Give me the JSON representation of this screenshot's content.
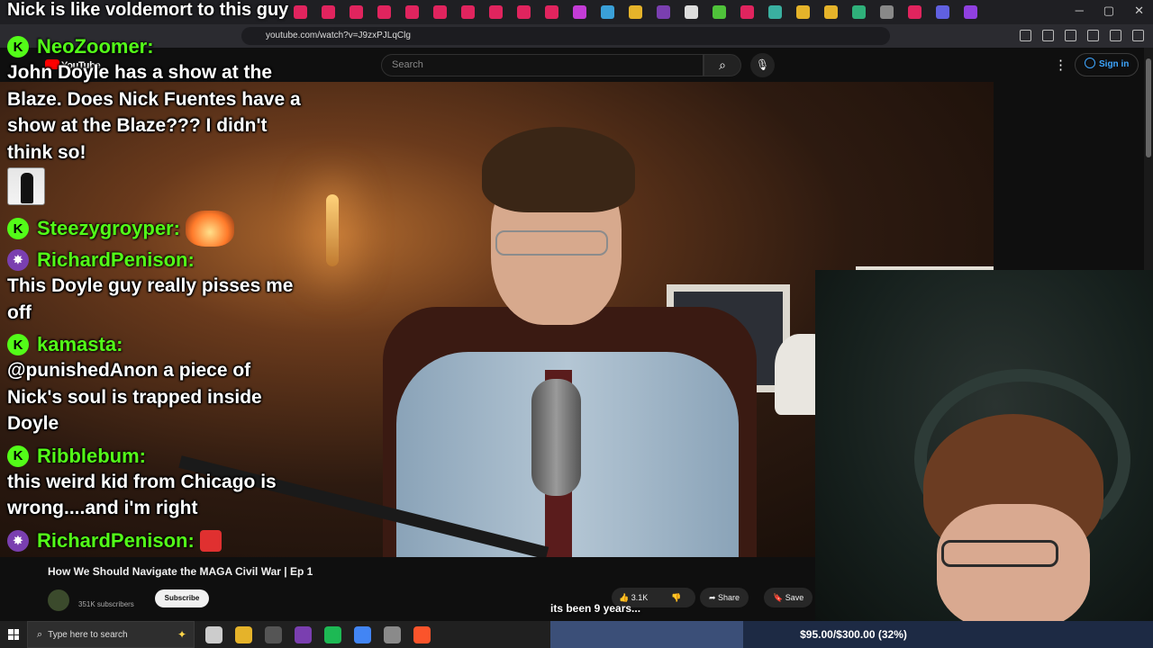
{
  "browser": {
    "tab_title": "Nick is like voldemort to this guy",
    "url": "youtube.com/watch?v=J9zxPJLqClg",
    "tab_icon_colors": [
      "#e0245e",
      "#e0245e",
      "#e0245e",
      "#e0245e",
      "#e0245e",
      "#e0245e",
      "#e0245e",
      "#e0245e",
      "#e0245e",
      "#e0245e",
      "#c43cd6",
      "#3aa0d8",
      "#e5b32a",
      "#7a3fb0",
      "#dddddd",
      "#4fc23a",
      "#e0245e",
      "#3ab0a0",
      "#e5b32a",
      "#e5b32a",
      "#2fb07a",
      "#888888",
      "#e0245e",
      "#6060e0",
      "#9040e0"
    ],
    "window_controls": [
      "─",
      "▢",
      "✕"
    ]
  },
  "youtube": {
    "logo_text": "YouTube",
    "search_placeholder": "Search",
    "search_icon": "search-icon",
    "mic_icon": "mic-icon",
    "signin_label": "Sign in",
    "video_title": "How We Should Navigate the MAGA Civil War | Ep 1",
    "subscribers": "351K subscribers",
    "subscribe_label": "Subscribe",
    "like_count": "3.1K",
    "share_label": "Share",
    "save_label": "Save"
  },
  "chat": [
    {
      "badge": "kick",
      "username": "NeoZoomer:",
      "text": "John Doyle has a show at the Blaze. Does Nick Fuentes have a show at the Blaze??? I didn't think so!",
      "emote": "man-emote"
    },
    {
      "badge": "kick",
      "username": "Steezygroyper:",
      "text": "",
      "emote": "explosion-emote"
    },
    {
      "badge": "sub",
      "username": "RichardPenison:",
      "text": "This Doyle guy really pisses me off",
      "emote": ""
    },
    {
      "badge": "kick",
      "username": "kamasta:",
      "text": "@punishedAnon a piece of Nick's soul is trapped inside Doyle",
      "emote": ""
    },
    {
      "badge": "kick",
      "username": "Ribblebum:",
      "text": "this weird kid from Chicago is wrong....and i'm right",
      "emote": ""
    },
    {
      "badge": "sub",
      "username": "RichardPenison:",
      "text": "",
      "emote": "angry-emote"
    }
  ],
  "caption": "its been 9 years...",
  "donation_goal": {
    "text": "$95.00/$300.00 (32%)",
    "fraction": 0.32,
    "bar_color": "#1d2a44",
    "fill_color": "#3b4f78"
  },
  "taskbar": {
    "search_placeholder": "Type here to search",
    "app_colors": [
      "#cccccc",
      "#e5b32a",
      "#555555",
      "#7a3fb0",
      "#1db954",
      "#4285f4",
      "#8a8a8a",
      "#fb542b"
    ]
  },
  "colors": {
    "kick_green": "#53fc18",
    "sub_purple": "#7a3fb0",
    "youtube_red": "#ff0000",
    "link_blue": "#3ea6ff"
  }
}
